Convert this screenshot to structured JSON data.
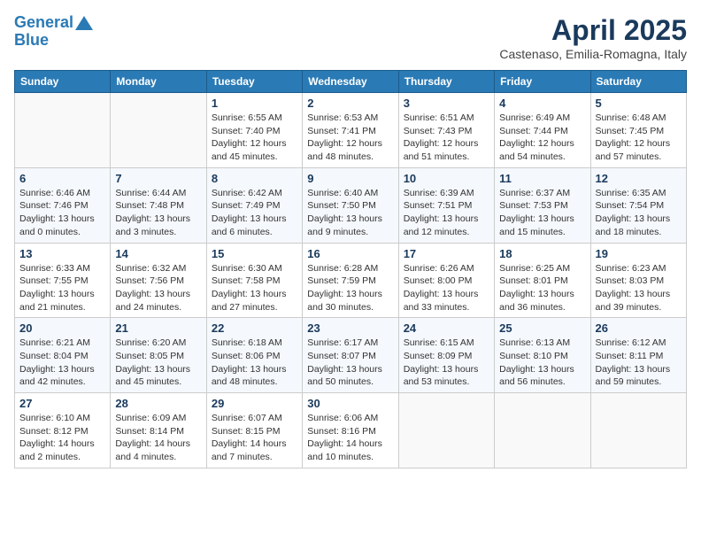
{
  "header": {
    "logo_line1": "General",
    "logo_line2": "Blue",
    "title": "April 2025",
    "subtitle": "Castenaso, Emilia-Romagna, Italy"
  },
  "weekdays": [
    "Sunday",
    "Monday",
    "Tuesday",
    "Wednesday",
    "Thursday",
    "Friday",
    "Saturday"
  ],
  "weeks": [
    [
      {
        "day": "",
        "info": ""
      },
      {
        "day": "",
        "info": ""
      },
      {
        "day": "1",
        "info": "Sunrise: 6:55 AM\nSunset: 7:40 PM\nDaylight: 12 hours\nand 45 minutes."
      },
      {
        "day": "2",
        "info": "Sunrise: 6:53 AM\nSunset: 7:41 PM\nDaylight: 12 hours\nand 48 minutes."
      },
      {
        "day": "3",
        "info": "Sunrise: 6:51 AM\nSunset: 7:43 PM\nDaylight: 12 hours\nand 51 minutes."
      },
      {
        "day": "4",
        "info": "Sunrise: 6:49 AM\nSunset: 7:44 PM\nDaylight: 12 hours\nand 54 minutes."
      },
      {
        "day": "5",
        "info": "Sunrise: 6:48 AM\nSunset: 7:45 PM\nDaylight: 12 hours\nand 57 minutes."
      }
    ],
    [
      {
        "day": "6",
        "info": "Sunrise: 6:46 AM\nSunset: 7:46 PM\nDaylight: 13 hours\nand 0 minutes."
      },
      {
        "day": "7",
        "info": "Sunrise: 6:44 AM\nSunset: 7:48 PM\nDaylight: 13 hours\nand 3 minutes."
      },
      {
        "day": "8",
        "info": "Sunrise: 6:42 AM\nSunset: 7:49 PM\nDaylight: 13 hours\nand 6 minutes."
      },
      {
        "day": "9",
        "info": "Sunrise: 6:40 AM\nSunset: 7:50 PM\nDaylight: 13 hours\nand 9 minutes."
      },
      {
        "day": "10",
        "info": "Sunrise: 6:39 AM\nSunset: 7:51 PM\nDaylight: 13 hours\nand 12 minutes."
      },
      {
        "day": "11",
        "info": "Sunrise: 6:37 AM\nSunset: 7:53 PM\nDaylight: 13 hours\nand 15 minutes."
      },
      {
        "day": "12",
        "info": "Sunrise: 6:35 AM\nSunset: 7:54 PM\nDaylight: 13 hours\nand 18 minutes."
      }
    ],
    [
      {
        "day": "13",
        "info": "Sunrise: 6:33 AM\nSunset: 7:55 PM\nDaylight: 13 hours\nand 21 minutes."
      },
      {
        "day": "14",
        "info": "Sunrise: 6:32 AM\nSunset: 7:56 PM\nDaylight: 13 hours\nand 24 minutes."
      },
      {
        "day": "15",
        "info": "Sunrise: 6:30 AM\nSunset: 7:58 PM\nDaylight: 13 hours\nand 27 minutes."
      },
      {
        "day": "16",
        "info": "Sunrise: 6:28 AM\nSunset: 7:59 PM\nDaylight: 13 hours\nand 30 minutes."
      },
      {
        "day": "17",
        "info": "Sunrise: 6:26 AM\nSunset: 8:00 PM\nDaylight: 13 hours\nand 33 minutes."
      },
      {
        "day": "18",
        "info": "Sunrise: 6:25 AM\nSunset: 8:01 PM\nDaylight: 13 hours\nand 36 minutes."
      },
      {
        "day": "19",
        "info": "Sunrise: 6:23 AM\nSunset: 8:03 PM\nDaylight: 13 hours\nand 39 minutes."
      }
    ],
    [
      {
        "day": "20",
        "info": "Sunrise: 6:21 AM\nSunset: 8:04 PM\nDaylight: 13 hours\nand 42 minutes."
      },
      {
        "day": "21",
        "info": "Sunrise: 6:20 AM\nSunset: 8:05 PM\nDaylight: 13 hours\nand 45 minutes."
      },
      {
        "day": "22",
        "info": "Sunrise: 6:18 AM\nSunset: 8:06 PM\nDaylight: 13 hours\nand 48 minutes."
      },
      {
        "day": "23",
        "info": "Sunrise: 6:17 AM\nSunset: 8:07 PM\nDaylight: 13 hours\nand 50 minutes."
      },
      {
        "day": "24",
        "info": "Sunrise: 6:15 AM\nSunset: 8:09 PM\nDaylight: 13 hours\nand 53 minutes."
      },
      {
        "day": "25",
        "info": "Sunrise: 6:13 AM\nSunset: 8:10 PM\nDaylight: 13 hours\nand 56 minutes."
      },
      {
        "day": "26",
        "info": "Sunrise: 6:12 AM\nSunset: 8:11 PM\nDaylight: 13 hours\nand 59 minutes."
      }
    ],
    [
      {
        "day": "27",
        "info": "Sunrise: 6:10 AM\nSunset: 8:12 PM\nDaylight: 14 hours\nand 2 minutes."
      },
      {
        "day": "28",
        "info": "Sunrise: 6:09 AM\nSunset: 8:14 PM\nDaylight: 14 hours\nand 4 minutes."
      },
      {
        "day": "29",
        "info": "Sunrise: 6:07 AM\nSunset: 8:15 PM\nDaylight: 14 hours\nand 7 minutes."
      },
      {
        "day": "30",
        "info": "Sunrise: 6:06 AM\nSunset: 8:16 PM\nDaylight: 14 hours\nand 10 minutes."
      },
      {
        "day": "",
        "info": ""
      },
      {
        "day": "",
        "info": ""
      },
      {
        "day": "",
        "info": ""
      }
    ]
  ]
}
